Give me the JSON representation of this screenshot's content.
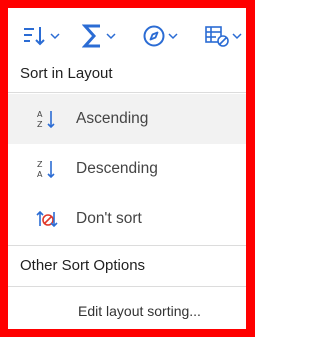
{
  "toolbar": {
    "buttons": [
      {
        "icon": "sort-icon"
      },
      {
        "icon": "sum-icon"
      },
      {
        "icon": "navigate-icon"
      },
      {
        "icon": "table-filter-icon"
      }
    ],
    "accent": "#2b6cd4"
  },
  "menu": {
    "sort_section_title": "Sort in Layout",
    "items": [
      {
        "label": "Ascending",
        "icon": "sort-ascending-icon",
        "selected": true
      },
      {
        "label": "Descending",
        "icon": "sort-descending-icon",
        "selected": false
      },
      {
        "label": "Don't sort",
        "icon": "dont-sort-icon",
        "selected": false
      }
    ],
    "other_section_title": "Other Sort Options",
    "edit_label": "Edit layout sorting..."
  },
  "colors": {
    "frame": "#ff0000",
    "hover_bg": "#f2f2f2",
    "dont_sort_red": "#e0392b"
  }
}
